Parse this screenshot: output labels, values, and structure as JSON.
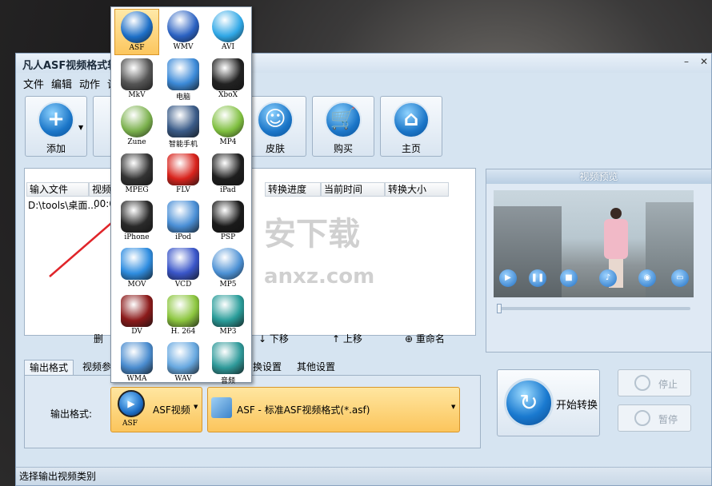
{
  "window": {
    "title": "凡人ASF视频格式转"
  },
  "menu": [
    "文件",
    "编辑",
    "动作",
    "设"
  ],
  "toolbar": {
    "add": "添加",
    "skin": "皮肤",
    "buy": "购买",
    "home": "主页"
  },
  "table": {
    "columns": [
      "输入文件",
      "视频",
      "转换进度",
      "当前时间",
      "转换大小"
    ],
    "rows": [
      {
        "file": "D:\\tools\\桌面...",
        "time": "00:0"
      }
    ]
  },
  "list_controls": {
    "delete": "删",
    "down": "下移",
    "up": "上移",
    "rename": "重命名"
  },
  "tabs": [
    "输出格式",
    "视频参",
    "换设置",
    "其他设置"
  ],
  "output": {
    "label": "输出格式:",
    "format_icon_label": "ASF",
    "format_name": "ASF视频",
    "profile": "ASF - 标准ASF视频格式(*.asf)"
  },
  "preview": {
    "title": "视频预览"
  },
  "actions": {
    "start": "开始转换",
    "stop": "停止",
    "pause": "暂停"
  },
  "status": "选择输出视频类别",
  "watermark": {
    "cn": "安下载",
    "en": "anxz.com"
  },
  "formats": [
    {
      "label": "ASF",
      "icon": "asf-play-icon",
      "color": "#1d6fc7"
    },
    {
      "label": "WMV",
      "icon": "wmv-play-icon",
      "color": "#2b62c2"
    },
    {
      "label": "AVI",
      "icon": "avi-play-icon",
      "color": "#2fa7e6"
    },
    {
      "label": "MkV",
      "icon": "film-reel-icon",
      "color": "#555555"
    },
    {
      "label": "电脑",
      "icon": "computer-monitor-icon",
      "color": "#3c8ad8"
    },
    {
      "label": "XboX",
      "icon": "gamepad-icon",
      "color": "#222222"
    },
    {
      "label": "Zune",
      "icon": "zune-player-icon",
      "color": "#7ab04c"
    },
    {
      "label": "智能手机",
      "icon": "smartphone-icon",
      "color": "#3a5b88"
    },
    {
      "label": "MP4",
      "icon": "mp4-player-icon",
      "color": "#7fbf3f"
    },
    {
      "label": "MPEG",
      "icon": "mpeg-reel-icon",
      "color": "#333333"
    },
    {
      "label": "FLV",
      "icon": "flash-icon",
      "color": "#d8231c"
    },
    {
      "label": "iPad",
      "icon": "tablet-icon",
      "color": "#1e1e1e"
    },
    {
      "label": "iPhone",
      "icon": "iphone-icon",
      "color": "#2a2a2a"
    },
    {
      "label": "iPod",
      "icon": "ipod-icon",
      "color": "#4a8fd6"
    },
    {
      "label": "PSP",
      "icon": "psp-icon",
      "color": "#1a1a1a"
    },
    {
      "label": "MOV",
      "icon": "quicktime-icon",
      "color": "#2f8de0"
    },
    {
      "label": "VCD",
      "icon": "disc-icon",
      "color": "#3a56c9"
    },
    {
      "label": "MP5",
      "icon": "mp5-player-icon",
      "color": "#4b90d4"
    },
    {
      "label": "DV",
      "icon": "camcorder-icon",
      "color": "#8b1a1a"
    },
    {
      "label": "H. 264",
      "icon": "h264-cube-icon",
      "color": "#8cc63f"
    },
    {
      "label": "MP3",
      "icon": "mp3-disc-icon",
      "color": "#2a9d9a"
    },
    {
      "label": "WMA",
      "icon": "music-folder-icon",
      "color": "#4a8ccf"
    },
    {
      "label": "WAV",
      "icon": "music-note-icon",
      "color": "#67a8e0"
    },
    {
      "label": "音频",
      "icon": "audio-icon",
      "color": "#2f9a9a"
    }
  ]
}
